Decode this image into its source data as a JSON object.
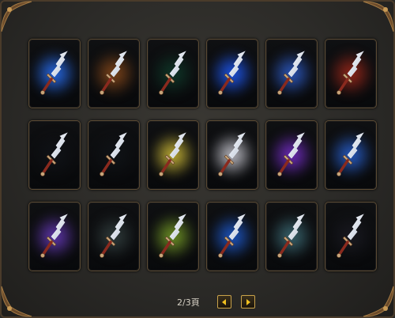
{
  "pagination": {
    "label": "2/3頁",
    "prev_icon": "chevron-left-icon",
    "next_icon": "chevron-right-icon",
    "accent": "#f0c020"
  },
  "skins": [
    {
      "glow": "#2a74ff",
      "label": ""
    },
    {
      "glow": "#8a4a1a",
      "label": ""
    },
    {
      "glow": "#0f3a2a",
      "label": ""
    },
    {
      "glow": "#1f5cff",
      "label": ""
    },
    {
      "glow": "#2f5fd0",
      "label": ""
    },
    {
      "glow": "#a0281a",
      "label": ""
    },
    {
      "glow": "#101318",
      "label": ""
    },
    {
      "glow": "#101418",
      "label": ""
    },
    {
      "glow": "#d7c33a",
      "label": ""
    },
    {
      "glow": "#cfcfd8",
      "label": ""
    },
    {
      "glow": "#7a2fd0",
      "label": ""
    },
    {
      "glow": "#2a64d8",
      "label": ""
    },
    {
      "glow": "#6a3bc0",
      "label": ""
    },
    {
      "glow": "#334040",
      "label": ""
    },
    {
      "glow": "#7aa228",
      "label": ""
    },
    {
      "glow": "#1f5ed8",
      "label": ""
    },
    {
      "glow": "#3e6f7a",
      "label": ""
    },
    {
      "glow": "#1a1a22",
      "label": ""
    }
  ]
}
